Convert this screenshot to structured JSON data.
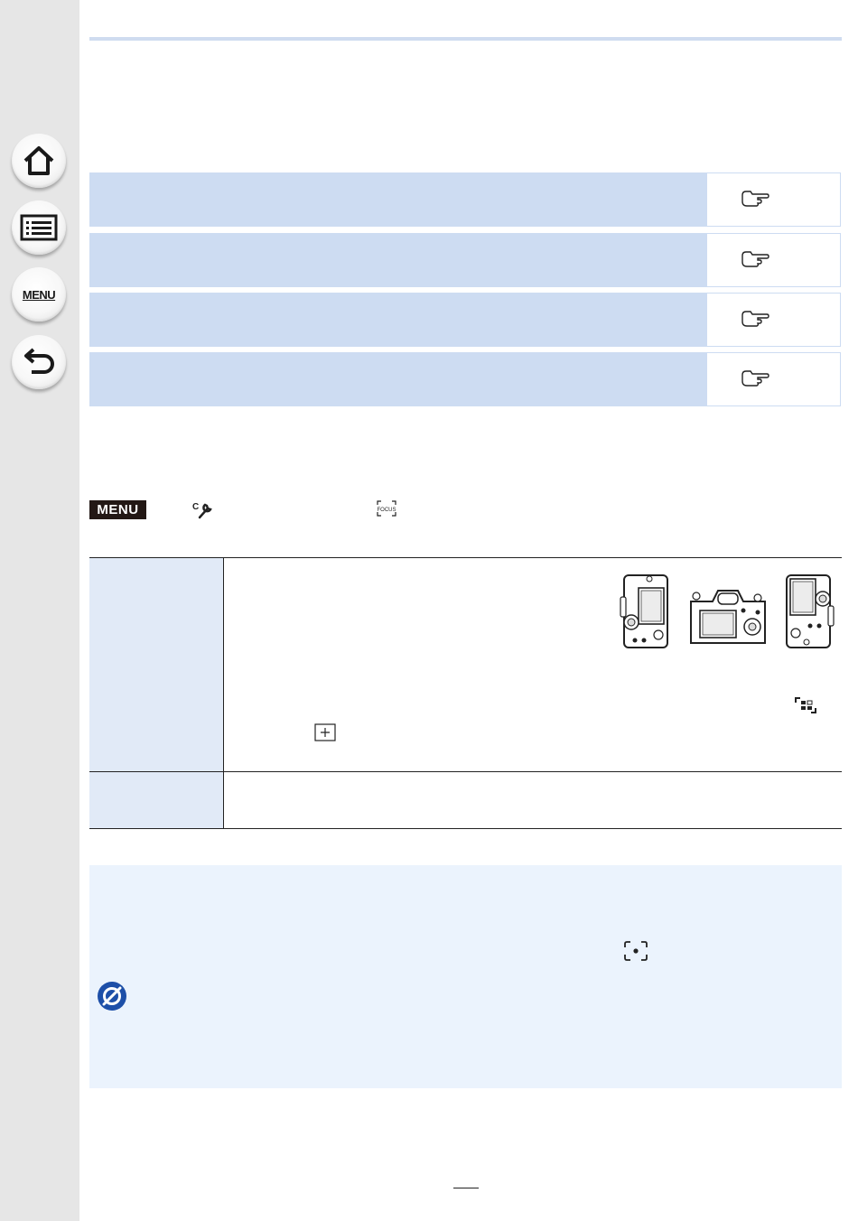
{
  "sidebar": {
    "buttons": [
      {
        "name": "home",
        "icon": "home-icon"
      },
      {
        "name": "contents",
        "icon": "list-icon"
      },
      {
        "name": "menu",
        "icon": "menu-icon",
        "label": "MENU"
      },
      {
        "name": "back",
        "icon": "return-icon"
      }
    ]
  },
  "feature_rows": [
    {
      "ref_icon": "pointing-hand-icon"
    },
    {
      "ref_icon": "pointing-hand-icon"
    },
    {
      "ref_icon": "pointing-hand-icon"
    },
    {
      "ref_icon": "pointing-hand-icon"
    }
  ],
  "menu_path": {
    "badge": "MENU",
    "icons": [
      "custom-wrench-icon",
      "focus-icon"
    ]
  },
  "settings_table": {
    "illustrations": [
      "camera-vertical-left-icon",
      "camera-horizontal-icon",
      "camera-vertical-right-icon"
    ],
    "inline_icons": [
      "multi-area-af-icon",
      "pinpoint-af-icon"
    ]
  },
  "note": {
    "icons": [
      "spot-af-icon",
      "not-available-icon"
    ]
  },
  "colors": {
    "sidebar": "#e6e6e6",
    "header_band": "#cddcf2",
    "table_label": "#e1eaf7",
    "note_background": "#ebf3fd",
    "accent_blue": "#1d4fa8"
  }
}
